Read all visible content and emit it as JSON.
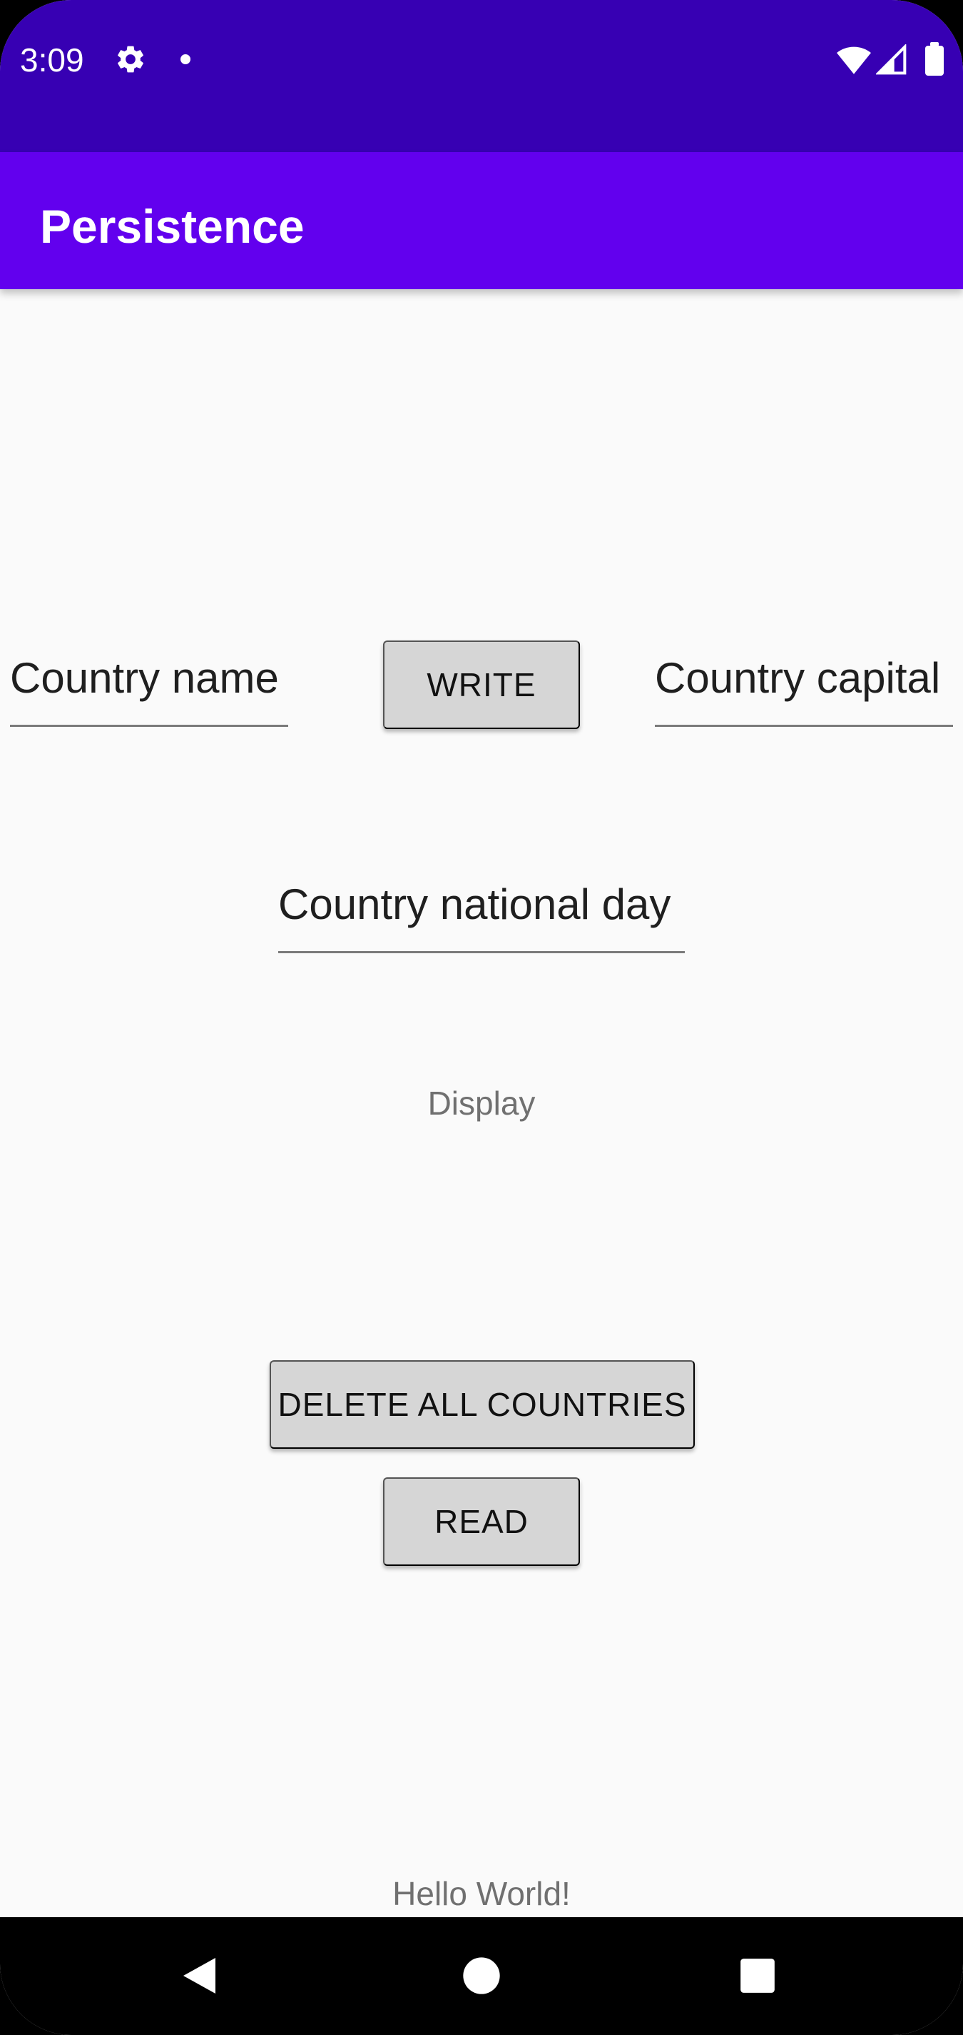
{
  "status_bar": {
    "time": "3:09",
    "icons": [
      "gear-icon",
      "notification-dot-icon",
      "wifi-icon",
      "signal-icon",
      "battery-icon"
    ]
  },
  "app_bar": {
    "title": "Persistence",
    "color": "#6200ee"
  },
  "form": {
    "country_name_placeholder": "Country name",
    "country_capital_placeholder": "Country capital",
    "country_national_day_placeholder": "Country national day",
    "write_button": "WRITE"
  },
  "display": {
    "text": "Display"
  },
  "actions": {
    "delete_all_button": "DELETE ALL COUNTRIES",
    "read_button": "READ"
  },
  "footer": {
    "text": "Hello World!"
  },
  "nav_bar": {
    "icons": [
      "back-icon",
      "home-icon",
      "recents-icon"
    ]
  },
  "colors": {
    "status_bar": "#3700b3",
    "app_bar": "#6200ee",
    "background": "#fafafa",
    "button": "#d6d6d6"
  }
}
